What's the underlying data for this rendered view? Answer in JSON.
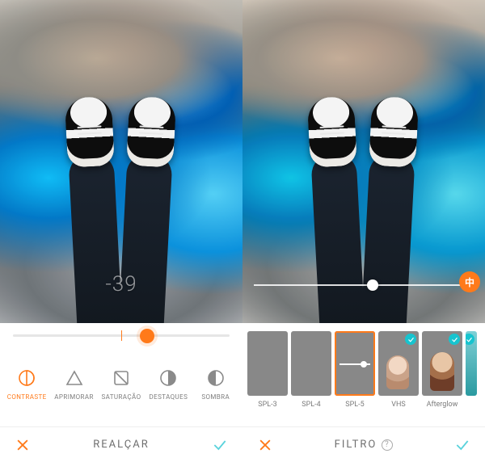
{
  "left": {
    "title": "REALÇAR",
    "value_overlay": "-39",
    "slider": {
      "position_pct": 62
    },
    "tools": [
      {
        "key": "contraste",
        "label": "CONTRASTE",
        "active": true
      },
      {
        "key": "aprimorar",
        "label": "APRIMORAR",
        "active": false
      },
      {
        "key": "saturacao",
        "label": "SATURAÇÃO",
        "active": false
      },
      {
        "key": "destaques",
        "label": "DESTAQUES",
        "active": false
      },
      {
        "key": "sombra",
        "label": "SOMBRA",
        "active": false
      }
    ]
  },
  "right": {
    "title": "FILTRO",
    "help_glyph": "?",
    "badge_glyph": "中",
    "mini_slider_pct": 54,
    "filters": [
      {
        "key": "spl3",
        "label": "SPL-3",
        "checked": false,
        "active": false
      },
      {
        "key": "spl4",
        "label": "SPL-4",
        "checked": false,
        "active": false
      },
      {
        "key": "spl5",
        "label": "SPL-5",
        "checked": false,
        "active": true
      },
      {
        "key": "vhs",
        "label": "VHS",
        "checked": true,
        "active": false
      },
      {
        "key": "afterglow",
        "label": "Afterglow",
        "checked": true,
        "active": false
      }
    ]
  },
  "colors": {
    "accent": "#ff7a1a",
    "confirm": "#5bd3dc"
  }
}
